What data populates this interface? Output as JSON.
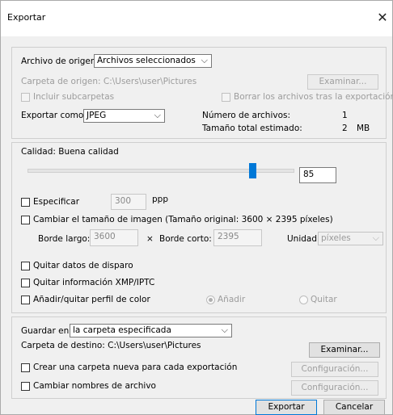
{
  "dialog": {
    "title": "Exportar"
  },
  "source": {
    "label": "Archivo de origen:",
    "select_value": "Archivos seleccionados",
    "folder_label": "Carpeta de origen: C:\\Users\\user\\Pictures",
    "browse_label": "Examinar...",
    "include_subfolders": "Incluir subcarpetas",
    "delete_after": "Borrar los archivos tras la exportación",
    "export_as_label": "Exportar como:",
    "export_as_value": "JPEG",
    "file_count_label": "Número de archivos:",
    "file_count_value": "1",
    "total_size_label": "Tamaño total estimado:",
    "total_size_value": "2",
    "total_size_unit": "MB"
  },
  "quality": {
    "label": "Calidad: Buena calidad",
    "value": "85",
    "slider_fraction": 0.85,
    "specify_label": "Especificar",
    "dpi_value": "300",
    "dpi_unit": "ppp",
    "resize_label": "Cambiar el tamaño de imagen (Tamaño original: 3600 × 2395 píxeles)",
    "long_edge_label": "Borde largo:",
    "long_edge_value": "3600",
    "times": "×",
    "short_edge_label": "Borde corto:",
    "short_edge_value": "2395",
    "unit_label": "Unidad:",
    "unit_value": "píxeles",
    "remove_shooting_data": "Quitar datos de disparo",
    "remove_xmp": "Quitar información XMP/IPTC",
    "color_profile": "Añadir/quitar perfil de color",
    "add_label": "Añadir",
    "remove_label": "Quitar"
  },
  "save": {
    "save_in_label": "Guardar en:",
    "save_in_value": "la carpeta especificada",
    "dest_folder_label": "Carpeta de destino: C:\\Users\\user\\Pictures",
    "browse_label": "Examinar...",
    "new_folder_label": "Crear una carpeta nueva para cada exportación",
    "config1_label": "Configuración...",
    "rename_label": "Cambiar nombres de archivo",
    "config2_label": "Configuración..."
  },
  "footer": {
    "export_label": "Exportar",
    "cancel_label": "Cancelar"
  },
  "icons": {
    "close": "close-icon",
    "chevron": "chevron-down-icon"
  }
}
